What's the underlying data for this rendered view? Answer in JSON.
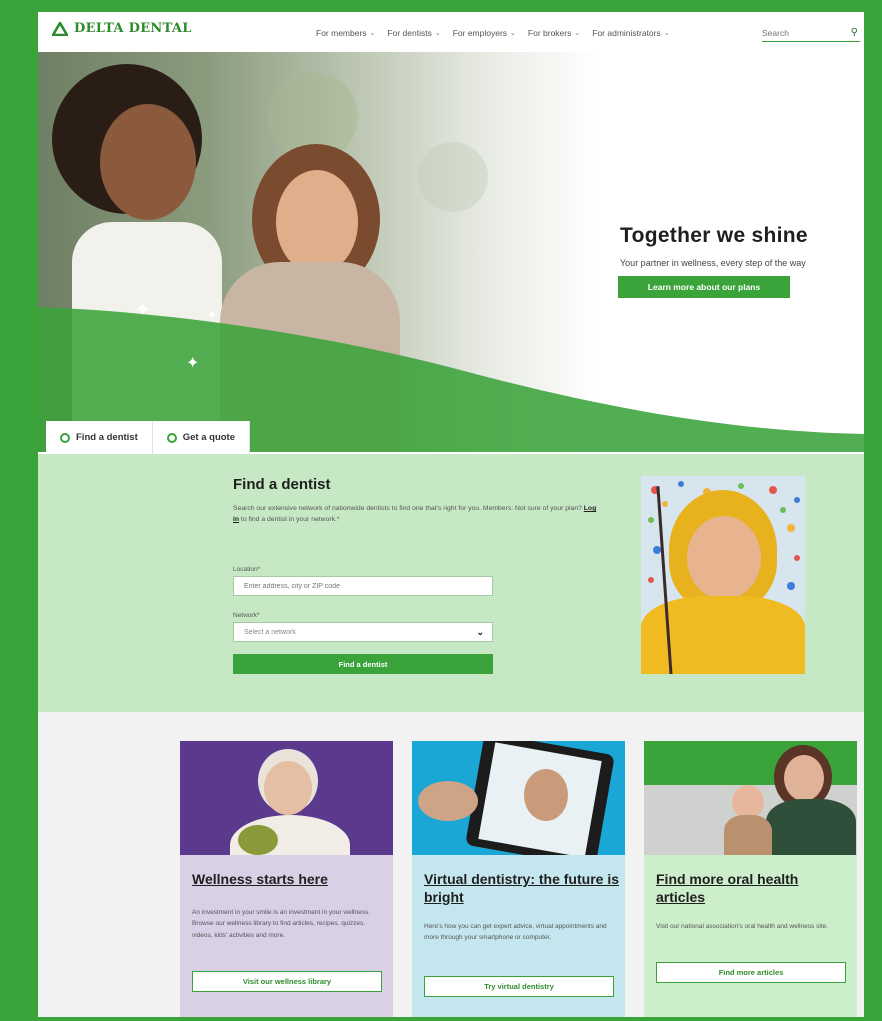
{
  "header": {
    "logo_text": "DELTA DENTAL",
    "nav": [
      {
        "label": "For members"
      },
      {
        "label": "For dentists"
      },
      {
        "label": "For employers"
      },
      {
        "label": "For brokers"
      },
      {
        "label": "For administrators"
      }
    ],
    "search_placeholder": "Search"
  },
  "hero": {
    "title": "Together we shine",
    "subtitle": "Your partner in wellness, every step of the way",
    "cta_label": "Learn more about our plans"
  },
  "tabs": [
    {
      "label": "Find a dentist"
    },
    {
      "label": "Get a quote"
    }
  ],
  "find_dentist": {
    "title": "Find a dentist",
    "desc_before": "Search our extensive network of nationwide dentists to find one that's right for you. Members: Not sure of your plan? ",
    "login_label": "Log in",
    "desc_after": " to find a dentist in your network.*",
    "location_label": "Location*",
    "location_placeholder": "Enter address, city or ZIP code",
    "network_label": "Network*",
    "network_value": "Select a network",
    "button_label": "Find a dentist"
  },
  "cards": [
    {
      "title": "Wellness starts here",
      "desc": "An investment in your smile is an investment in your wellness. Browse our wellness library to find articles, recipes, quizzes, videos, kids' activities and more.",
      "button": "Visit our wellness library"
    },
    {
      "title": "Virtual dentistry: the future is bright",
      "desc": "Here's how you can get expert advice, virtual appointments and more through your smartphone or computer.",
      "button": "Try virtual dentistry"
    },
    {
      "title": "Find more oral health articles",
      "desc": "Visit our national association's oral health and wellness site.",
      "button": "Find more articles"
    }
  ],
  "colors": {
    "brand_green": "#3aa33a",
    "light_green": "#c6e8c4",
    "card1_bg": "#d9d0e6",
    "card2_bg": "#c4e6ee",
    "card3_bg": "#cdeecb"
  },
  "icons": [
    "delta-logo-icon",
    "chevron-down-icon",
    "search-icon",
    "radio-circle-icon",
    "sparkle-icon",
    "select-caret-icon"
  ]
}
